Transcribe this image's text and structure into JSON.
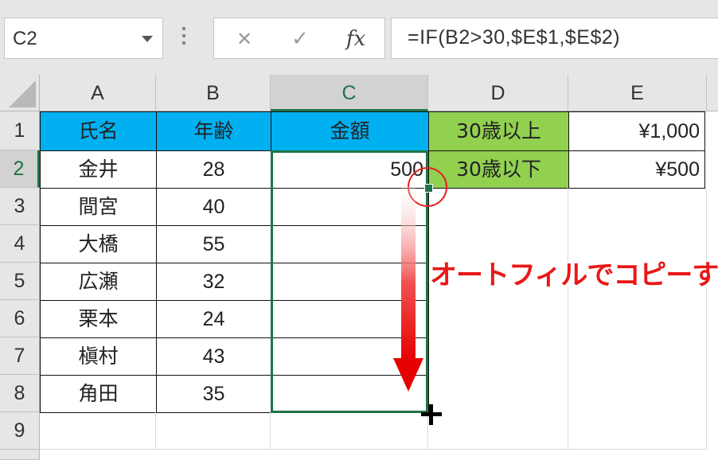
{
  "formula_bar": {
    "name_box": "C2",
    "cancel_icon": "✕",
    "enter_icon": "✓",
    "fx_label": "fx",
    "formula": "=IF(B2>30,$E$1,$E$2)"
  },
  "columns": [
    "A",
    "B",
    "C",
    "D",
    "E"
  ],
  "selected_column": "C",
  "rows": [
    "1",
    "2",
    "3",
    "4",
    "5",
    "6",
    "7",
    "8",
    "9"
  ],
  "selected_row": "2",
  "header_row": {
    "name": "氏名",
    "age": "年齢",
    "amount": "金額"
  },
  "data_rows": [
    {
      "name": "金井",
      "age": "28",
      "amount": "500"
    },
    {
      "name": "間宮",
      "age": "40",
      "amount": ""
    },
    {
      "name": "大橋",
      "age": "55",
      "amount": ""
    },
    {
      "name": "広瀬",
      "age": "32",
      "amount": ""
    },
    {
      "name": "栗本",
      "age": "24",
      "amount": ""
    },
    {
      "name": "槇村",
      "age": "43",
      "amount": ""
    },
    {
      "name": "角田",
      "age": "35",
      "amount": ""
    }
  ],
  "lookup": [
    {
      "label": "30歳以上",
      "value": "¥1,000"
    },
    {
      "label": "30歳以下",
      "value": "¥500"
    }
  ],
  "annotation": "オートフィルでコピーする",
  "colors": {
    "header_blue": "#00b0f0",
    "lookup_green": "#92d050",
    "selection_green": "#217346",
    "annotation_red": "#e81818"
  }
}
